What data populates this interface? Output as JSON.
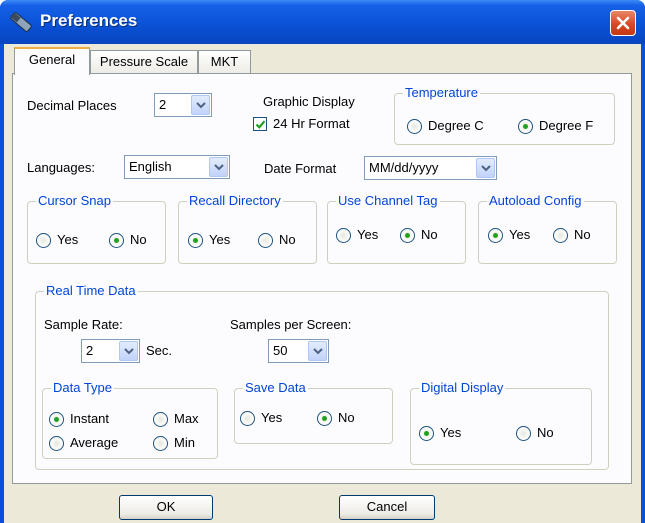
{
  "window": {
    "title": "Preferences"
  },
  "tabs": [
    "General",
    "Pressure Scale",
    "MKT"
  ],
  "general": {
    "decimal_places": {
      "label": "Decimal Places",
      "value": "2"
    },
    "graphic_display": {
      "label": "Graphic Display",
      "checkbox_label": "24 Hr Format",
      "checked": true
    },
    "temperature": {
      "title": "Temperature",
      "option_c": "Degree C",
      "option_f": "Degree F",
      "selected": "Degree F"
    },
    "languages": {
      "label": "Languages:",
      "value": "English"
    },
    "date_format": {
      "label": "Date Format",
      "value": "MM/dd/yyyy"
    },
    "cursor_snap": {
      "title": "Cursor Snap",
      "yes": "Yes",
      "no": "No",
      "selected": "No"
    },
    "recall_directory": {
      "title": "Recall Directory",
      "yes": "Yes",
      "no": "No",
      "selected": "Yes"
    },
    "use_channel_tag": {
      "title": "Use Channel Tag",
      "yes": "Yes",
      "no": "No",
      "selected": "No"
    },
    "autoload_config": {
      "title": "Autoload Config",
      "yes": "Yes",
      "no": "No",
      "selected": "Yes"
    },
    "real_time_data": {
      "title": "Real Time Data",
      "sample_rate": {
        "label": "Sample Rate:",
        "value": "2",
        "unit": "Sec."
      },
      "samples_per_screen": {
        "label": "Samples per Screen:",
        "value": "50"
      },
      "data_type": {
        "title": "Data Type",
        "instant": "Instant",
        "max": "Max",
        "average": "Average",
        "min": "Min",
        "selected": "Instant"
      },
      "save_data": {
        "title": "Save Data",
        "yes": "Yes",
        "no": "No",
        "selected": "No"
      },
      "digital_display": {
        "title": "Digital Display",
        "yes": "Yes",
        "no": "No",
        "selected": "Yes"
      }
    }
  },
  "buttons": {
    "ok": "OK",
    "cancel": "Cancel"
  }
}
